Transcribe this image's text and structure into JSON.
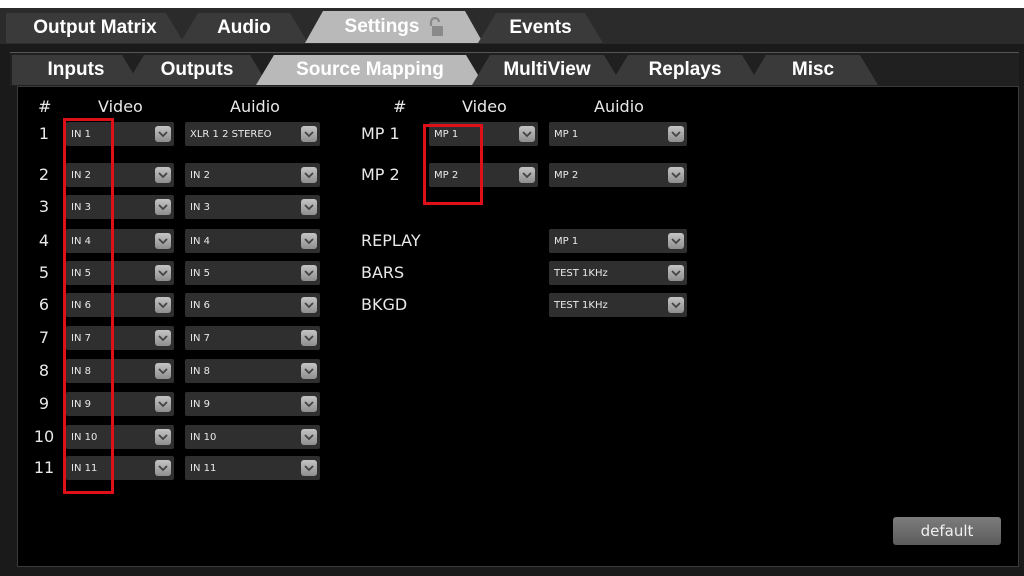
{
  "top_tabs": [
    {
      "label": "Output Matrix",
      "active": false
    },
    {
      "label": "Audio",
      "active": false
    },
    {
      "label": "Settings",
      "active": true,
      "icon": "lock-icon"
    },
    {
      "label": "Events",
      "active": false
    }
  ],
  "sub_tabs": [
    {
      "label": "Inputs",
      "active": false
    },
    {
      "label": "Outputs",
      "active": false
    },
    {
      "label": "Source Mapping",
      "active": true
    },
    {
      "label": "MultiView",
      "active": false
    },
    {
      "label": "Replays",
      "active": false
    },
    {
      "label": "Misc",
      "active": false
    }
  ],
  "inputs_table": {
    "headers": {
      "num": "#",
      "video": "Video",
      "audio": "Auidio"
    },
    "rows": [
      {
        "num": "1",
        "video": "IN 1",
        "audio": "XLR 1 2 STEREO"
      },
      {
        "num": "2",
        "video": "IN 2",
        "audio": "IN 2"
      },
      {
        "num": "3",
        "video": "IN 3",
        "audio": "IN 3"
      },
      {
        "num": "4",
        "video": "IN 4",
        "audio": "IN 4"
      },
      {
        "num": "5",
        "video": "IN 5",
        "audio": "IN 5"
      },
      {
        "num": "6",
        "video": "IN 6",
        "audio": "IN 6"
      },
      {
        "num": "7",
        "video": "IN 7",
        "audio": "IN 7"
      },
      {
        "num": "8",
        "video": "IN 8",
        "audio": "IN 8"
      },
      {
        "num": "9",
        "video": "IN 9",
        "audio": "IN 9"
      },
      {
        "num": "10",
        "video": "IN 10",
        "audio": "IN 10"
      },
      {
        "num": "11",
        "video": "IN 11",
        "audio": "IN 11"
      }
    ]
  },
  "mp_table": {
    "headers": {
      "num": "#",
      "video": "Video",
      "audio": "Auidio"
    },
    "rows": [
      {
        "label": "MP 1",
        "video": "MP 1",
        "audio": "MP 1"
      },
      {
        "label": "MP 2",
        "video": "MP 2",
        "audio": "MP 2"
      },
      {
        "label": "REPLAY",
        "audio": "MP 1"
      },
      {
        "label": "BARS",
        "audio": "TEST 1KHz"
      },
      {
        "label": "BKGD",
        "audio": "TEST 1KHz"
      }
    ]
  },
  "default_button": "default",
  "colors": {
    "highlight": "#e0101a",
    "active_tab": "#b9b9b9",
    "inactive_tab": "#3a3a3a"
  }
}
